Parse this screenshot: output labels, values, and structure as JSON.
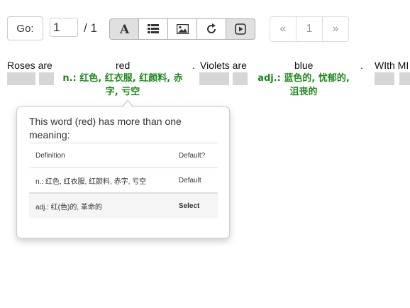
{
  "toolbar": {
    "go_label": "Go:",
    "page_value": "1",
    "page_total": "/ 1",
    "buttons": [
      {
        "name": "font-button",
        "icon": "font-icon"
      },
      {
        "name": "list-button",
        "icon": "list-icon"
      },
      {
        "name": "image-button",
        "icon": "image-icon"
      },
      {
        "name": "share-button",
        "icon": "share-icon"
      },
      {
        "name": "play-button",
        "icon": "play-icon"
      }
    ]
  },
  "pager": {
    "prev": "«",
    "page": "1",
    "next": "»"
  },
  "reader": {
    "words": [
      "Roses are",
      "red",
      ".",
      "Violets are",
      "blue",
      ".",
      "WIth MI"
    ],
    "gloss_red": [
      "n.: 红色, 红衣服, 红颜料, 赤",
      "字, 亏空"
    ],
    "gloss_blue": [
      "adj.: 蓝色的, 忧郁的,",
      "沮丧的"
    ]
  },
  "popover": {
    "title": "This word (red) has more than one meaning:",
    "columns": [
      "Definition",
      "Default?"
    ],
    "rows": [
      {
        "definition": "n.: 红色, 红衣服, 红颜料, 赤字, 亏空",
        "action": "Default"
      },
      {
        "definition": "adj.: 红(色)的, 革命的",
        "action": "Select"
      }
    ]
  },
  "colors": {
    "gloss": "#1a8a1a",
    "placeholder": "#d6d6d6"
  }
}
